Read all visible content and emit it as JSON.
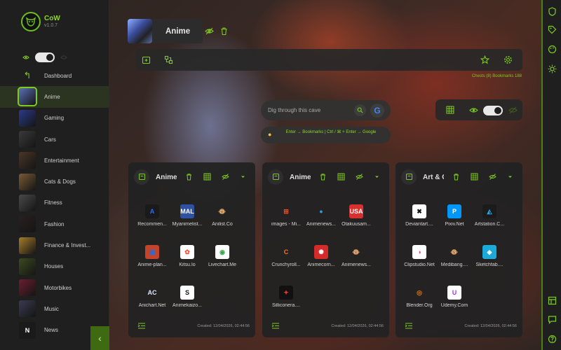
{
  "app": {
    "name": "CoW",
    "version": "v1.0.7"
  },
  "sidebar": {
    "items": [
      {
        "label": "Dashboard",
        "icon": "back-arrow-icon",
        "color": ""
      },
      {
        "label": "Anime",
        "color": "#5b6fb5",
        "active": true
      },
      {
        "label": "Gaming",
        "color": "#2b3a8a"
      },
      {
        "label": "Cars",
        "color": "#3a3a3a"
      },
      {
        "label": "Entertainment",
        "color": "#4a3626"
      },
      {
        "label": "Cats & Dogs",
        "color": "#7a5a36"
      },
      {
        "label": "Fitness",
        "color": "#4a4a4a"
      },
      {
        "label": "Fashion",
        "color": "#2a2020"
      },
      {
        "label": "Finance & Invest...",
        "color": "#a67c2a"
      },
      {
        "label": "Houses",
        "color": "#3c4a1e"
      },
      {
        "label": "Motorbikes",
        "color": "#6a1e2e"
      },
      {
        "label": "Music",
        "color": "#3a3a52"
      },
      {
        "label": "News",
        "color": "#222222",
        "letter": "N"
      }
    ],
    "collapse_icon": "chevron-left-icon"
  },
  "header": {
    "title": "Anime"
  },
  "toolbar": {
    "counts": "Chests (8) Bookmarks 188"
  },
  "search": {
    "placeholder": "Dig through this cave",
    "google_label": "G",
    "hint": "Enter → Bookmarks | Ctrl / ⌘ + Enter → Google"
  },
  "cards": [
    {
      "title": "Anime",
      "created": "Created: 12/04/2026, 02:44:56",
      "bookmarks": [
        {
          "label": "Recommen...",
          "glyph": "A",
          "bg": "#1a1a1a",
          "fg": "#2d6bff"
        },
        {
          "label": "Myanimelist...",
          "glyph": "MAL",
          "bg": "#2e51a2",
          "fg": "#ffffff"
        },
        {
          "label": "Anilist.Co",
          "glyph": "🐵",
          "bg": "transparent",
          "fg": "#e08a2a"
        },
        {
          "label": "Anime-plan...",
          "glyph": "▣",
          "bg": "#c2452b",
          "fg": "#2a6bd6"
        },
        {
          "label": "Kitsu.Io",
          "glyph": "✿",
          "bg": "#ffffff",
          "fg": "#f75239"
        },
        {
          "label": "Livechart.Me",
          "glyph": "◉",
          "bg": "#ffffff",
          "fg": "#3aa64a"
        },
        {
          "label": "Anichart.Net",
          "glyph": "AC",
          "bg": "transparent",
          "fg": "#dbe8ff"
        },
        {
          "label": "Animekaizo...",
          "glyph": "S",
          "bg": "#ffffff",
          "fg": "#111111"
        }
      ]
    },
    {
      "title": "Anime",
      "created": "Created: 12/04/2026, 02:44:56",
      "bookmarks": [
        {
          "label": "images - Mi...",
          "glyph": "⊞",
          "bg": "transparent",
          "fg": "#f25022"
        },
        {
          "label": "Animenews...",
          "glyph": "●",
          "bg": "transparent",
          "fg": "#2aa0d6"
        },
        {
          "label": "Otakuusam...",
          "glyph": "USA",
          "bg": "#d82f2f",
          "fg": "#ffffff"
        },
        {
          "label": "Crunchyroll...",
          "glyph": "C",
          "bg": "transparent",
          "fg": "#f47521"
        },
        {
          "label": "Animecorn...",
          "glyph": "✺",
          "bg": "#d62b2b",
          "fg": "#ffffff"
        },
        {
          "label": "Animenews...",
          "glyph": "🐵",
          "bg": "transparent",
          "fg": "#e08a2a"
        },
        {
          "label": "Silliconera....",
          "glyph": "✦",
          "bg": "#111111",
          "fg": "#e33"
        }
      ]
    },
    {
      "title": "Art & C",
      "created": "Created: 12/04/2026, 02:44:56",
      "bookmarks": [
        {
          "label": "Deviantart....",
          "glyph": "✖",
          "bg": "#ffffff",
          "fg": "#111111"
        },
        {
          "label": "Pixiv.Net",
          "glyph": "P",
          "bg": "#0096fa",
          "fg": "#ffffff"
        },
        {
          "label": "Artstation.C...",
          "glyph": "◭",
          "bg": "#1b1b1b",
          "fg": "#13aff0"
        },
        {
          "label": "Clipstudio.Net",
          "glyph": "◑",
          "bg": "#ffffff",
          "fg": "#e0467c"
        },
        {
          "label": "Medibang....",
          "glyph": "🐵",
          "bg": "transparent",
          "fg": "#e08a2a"
        },
        {
          "label": "Sketchfab....",
          "glyph": "◈",
          "bg": "#1caad9",
          "fg": "#ffffff"
        },
        {
          "label": "Blender.Org",
          "glyph": "◎",
          "bg": "transparent",
          "fg": "#ea7600"
        },
        {
          "label": "Udemy.Com",
          "glyph": "U",
          "bg": "#ffffff",
          "fg": "#a435f0"
        }
      ]
    }
  ],
  "colors": {
    "accent": "#7ecb20",
    "sidebar": "#1f1f1f"
  }
}
